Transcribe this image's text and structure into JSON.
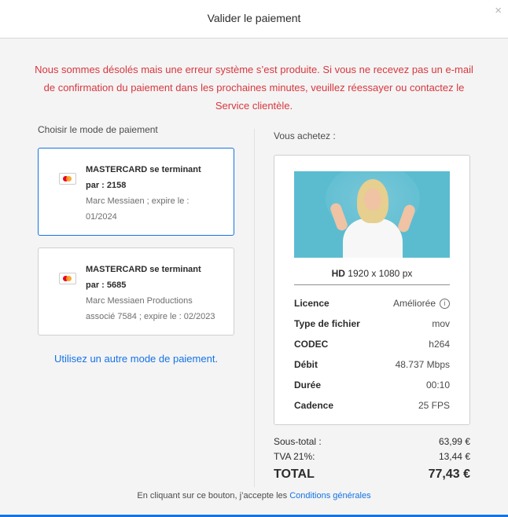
{
  "dialog": {
    "title": "Valider le paiement",
    "close_label": "×"
  },
  "error": {
    "message": "Nous sommes désolés mais une erreur système s’est produite. Si vous ne recevez pas un e-mail de confirmation du paiement dans les prochaines minutes, veuillez réessayer ou contactez le Service clientèle."
  },
  "payment": {
    "title": "Choisir le mode de paiement",
    "cards": [
      {
        "name_line1": "MASTERCARD se terminant",
        "name_line2": "par : 2158",
        "holder_line1": "Marc Messiaen ; expire le :",
        "holder_line2": "01/2024",
        "selected": true
      },
      {
        "name_line1": "MASTERCARD se terminant",
        "name_line2": "par : 5685",
        "holder_line1": "Marc Messiaen Productions",
        "holder_line2": "associé 7584 ; expire le : 02/2023",
        "selected": false
      }
    ],
    "alt_link": "Utilisez un autre mode de paiement."
  },
  "purchase": {
    "title": "Vous achetez :",
    "resolution_label": "HD",
    "resolution_value": "1920 x 1080 px",
    "specs": [
      {
        "key": "Licence",
        "value": "Améliorée"
      },
      {
        "key": "Type de fichier",
        "value": "mov"
      },
      {
        "key": "CODEC",
        "value": "h264"
      },
      {
        "key": "Débit",
        "value": "48.737 Mbps"
      },
      {
        "key": "Durée",
        "value": "00:10"
      },
      {
        "key": "Cadence",
        "value": "25 FPS"
      }
    ],
    "info_icon": "i"
  },
  "totals": {
    "subtotal_label": "Sous-total :",
    "subtotal_value": "63,99 €",
    "tax_label": "TVA 21%:",
    "tax_value": "13,44 €",
    "total_label": "TOTAL",
    "total_value": "77,43 €"
  },
  "terms": {
    "text": "En cliquant sur ce bouton, j’accepte les",
    "link": "Conditions générales"
  },
  "colors": {
    "accent": "#1473e6",
    "error": "#d7373f"
  }
}
